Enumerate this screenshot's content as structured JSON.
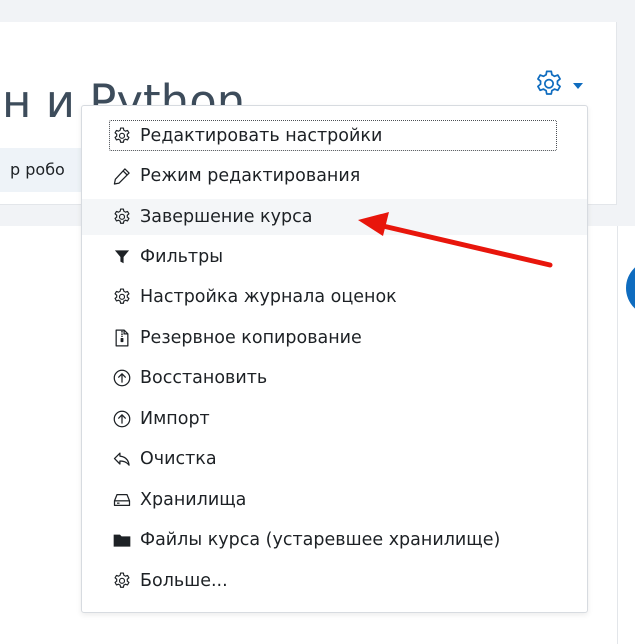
{
  "header": {
    "title": "н и Python",
    "subtitle_chip": "р робо"
  },
  "actions_menu": {
    "trigger_icon": "gear-icon",
    "accent_color": "#0f6cbf",
    "items": [
      {
        "label": "Редактировать настройки",
        "icon": "gear-icon"
      },
      {
        "label": "Режим редактирования",
        "icon": "pencil-icon"
      },
      {
        "label": "Завершение курса",
        "icon": "gear-icon"
      },
      {
        "label": "Фильтры",
        "icon": "filter-icon"
      },
      {
        "label": "Настройка журнала оценок",
        "icon": "gear-icon"
      },
      {
        "label": "Резервное копирование",
        "icon": "archive-file-icon"
      },
      {
        "label": "Восстановить",
        "icon": "upload-circle-icon"
      },
      {
        "label": "Импорт",
        "icon": "upload-circle-icon"
      },
      {
        "label": "Очистка",
        "icon": "undo-arrow-icon"
      },
      {
        "label": "Хранилища",
        "icon": "hard-drive-icon"
      },
      {
        "label": "Файлы курса (устаревшее хранилище)",
        "icon": "folder-icon"
      },
      {
        "label": "Больше...",
        "icon": "gear-icon"
      }
    ]
  },
  "annotation": {
    "icon": "red-arrow-icon",
    "color": "#e8160c"
  }
}
